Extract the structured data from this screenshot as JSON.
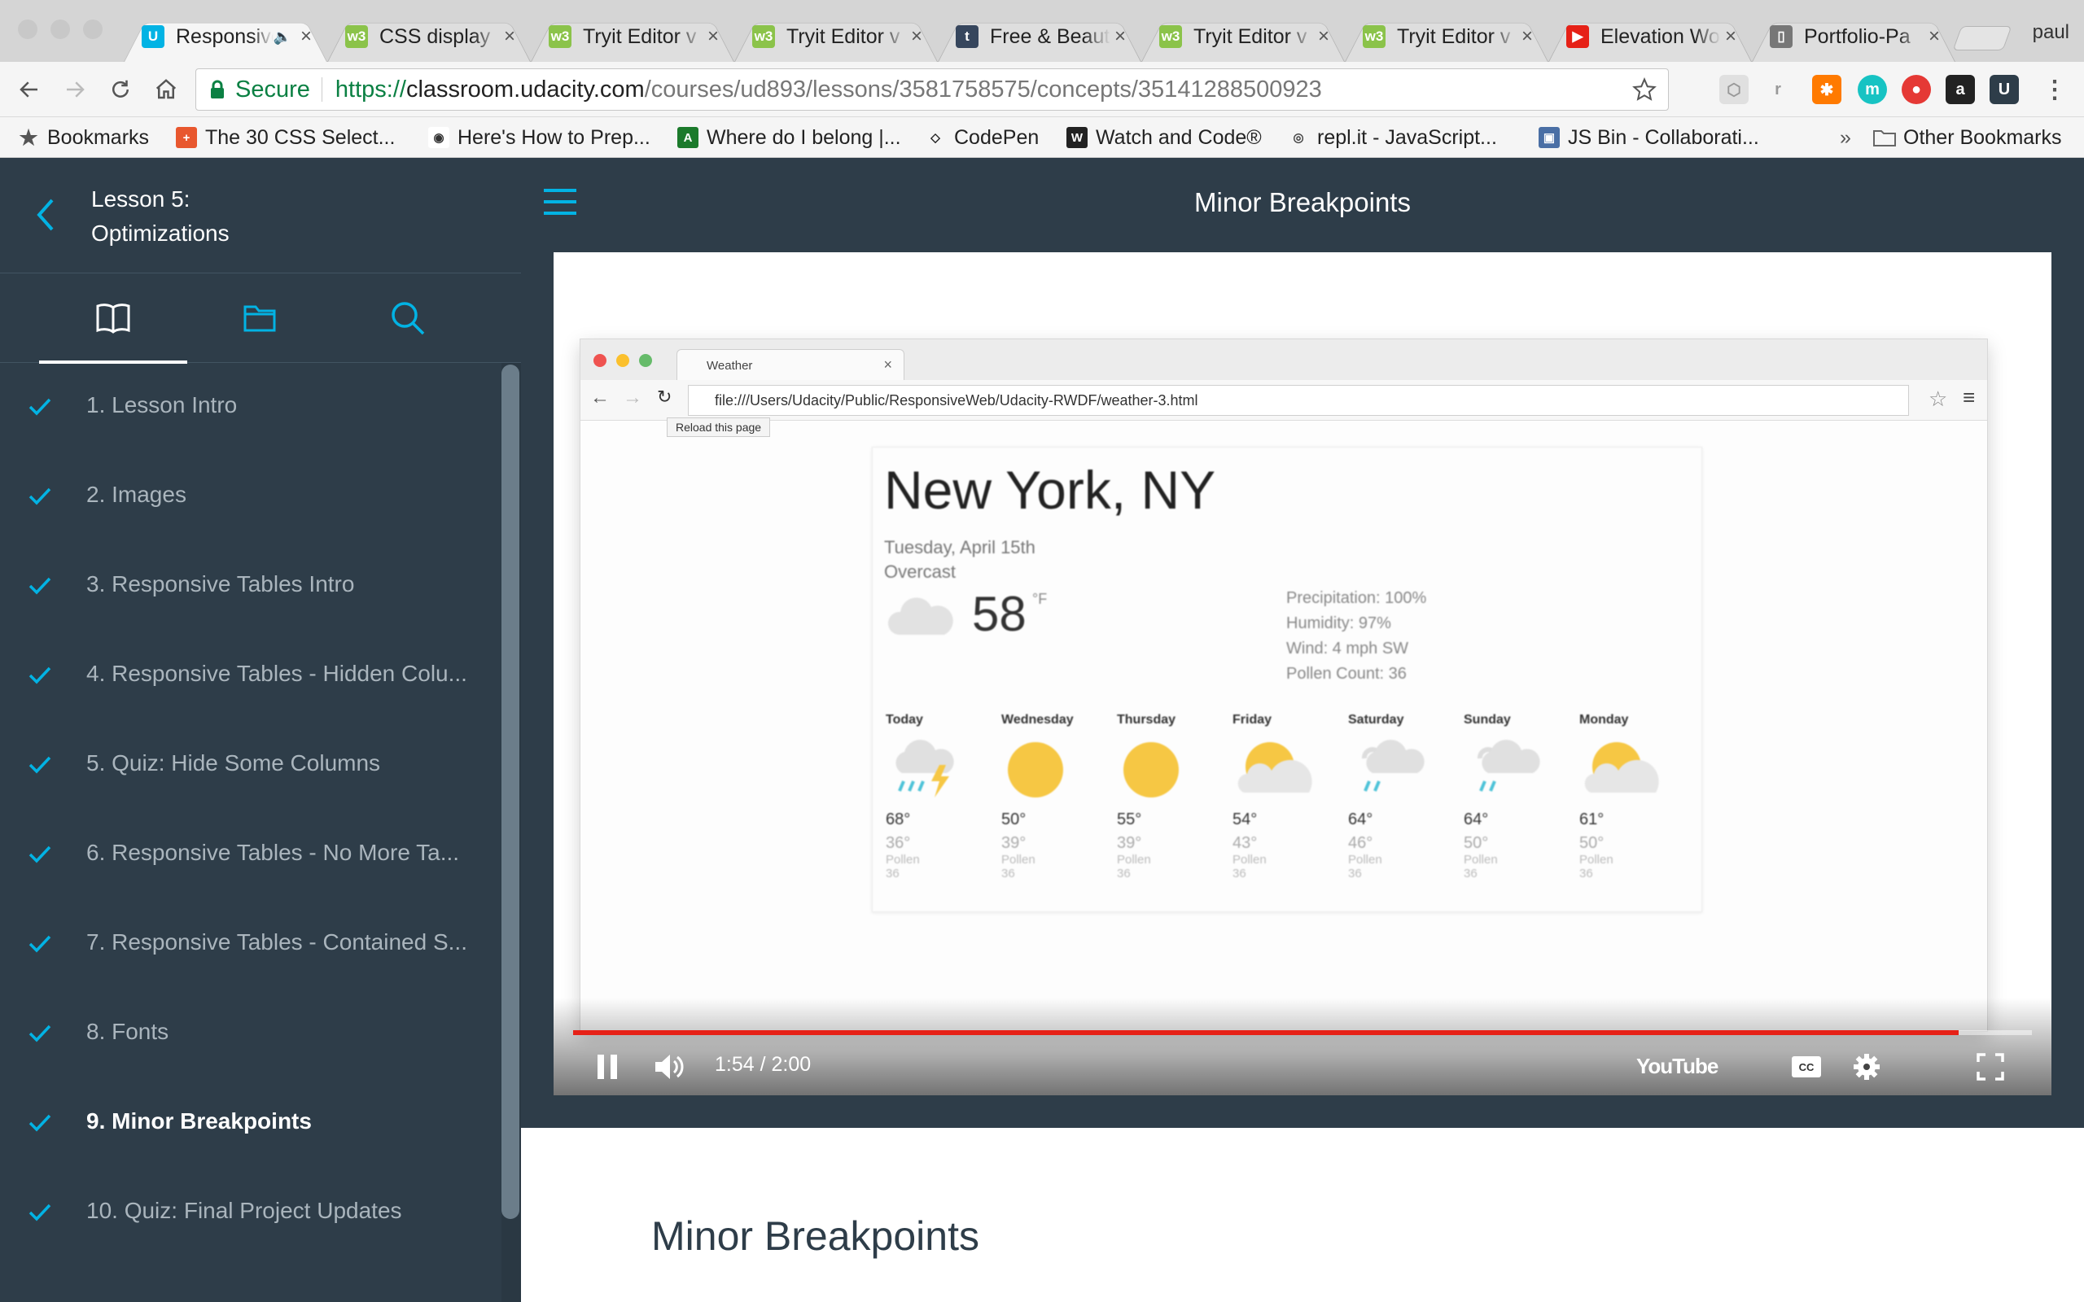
{
  "browser": {
    "profile": "paul",
    "tabs": [
      {
        "title": "Responsive",
        "favicon": "udacity-icon",
        "color": "#02b3e4",
        "active": true,
        "audio": true
      },
      {
        "title": "CSS display",
        "favicon": "w3schools-icon",
        "color": "#8bc34a",
        "active": false
      },
      {
        "title": "Tryit Editor v",
        "favicon": "w3schools-icon",
        "color": "#8bc34a",
        "active": false
      },
      {
        "title": "Tryit Editor v",
        "favicon": "w3schools-icon",
        "color": "#8bc34a",
        "active": false
      },
      {
        "title": "Free & Beaut",
        "favicon": "tumblr-icon",
        "color": "#36465d",
        "active": false
      },
      {
        "title": "Tryit Editor v",
        "favicon": "w3schools-icon",
        "color": "#8bc34a",
        "active": false
      },
      {
        "title": "Tryit Editor v",
        "favicon": "w3schools-icon",
        "color": "#8bc34a",
        "active": false
      },
      {
        "title": "Elevation Wo",
        "favicon": "youtube-icon",
        "color": "#e62117",
        "active": false
      },
      {
        "title": "Portfolio-Pa",
        "favicon": "document-icon",
        "color": "#777777",
        "active": false
      }
    ],
    "secure_label": "Secure",
    "url": {
      "scheme": "https://",
      "host": "classroom.udacity.com",
      "path": "/courses/ud893/lessons/3581758575/concepts/35141288500923"
    },
    "bookmarks": [
      {
        "label": "Bookmarks",
        "icon": "star-icon"
      },
      {
        "label": "The 30 CSS Select...",
        "icon": "plus-icon"
      },
      {
        "label": "Here's How to Prep...",
        "icon": "reddit-icon"
      },
      {
        "label": "Where do I belong |...",
        "icon": "site-icon"
      },
      {
        "label": "CodePen",
        "icon": "codepen-icon"
      },
      {
        "label": "Watch and Code®",
        "icon": "w-icon"
      },
      {
        "label": "repl.it - JavaScript...",
        "icon": "replit-icon"
      },
      {
        "label": "JS Bin - Collaborati...",
        "icon": "jsbin-icon"
      }
    ],
    "overflow": "»",
    "other_bookmarks": "Other Bookmarks"
  },
  "sidebar": {
    "lesson_line1": "Lesson 5:",
    "lesson_line2": "Optimizations",
    "items": [
      {
        "label": "1. Lesson Intro",
        "current": false
      },
      {
        "label": "2. Images",
        "current": false
      },
      {
        "label": "3. Responsive Tables Intro",
        "current": false
      },
      {
        "label": "4. Responsive Tables - Hidden Colu...",
        "current": false
      },
      {
        "label": "5. Quiz: Hide Some Columns",
        "current": false
      },
      {
        "label": "6. Responsive Tables - No More Ta...",
        "current": false
      },
      {
        "label": "7. Responsive Tables - Contained S...",
        "current": false
      },
      {
        "label": "8. Fonts",
        "current": false
      },
      {
        "label": "9. Minor Breakpoints",
        "current": true
      },
      {
        "label": "10. Quiz: Final Project Updates",
        "current": false
      }
    ]
  },
  "main": {
    "title": "Minor Breakpoints",
    "article_heading": "Minor Breakpoints"
  },
  "video": {
    "tab_title": "Weather",
    "url": "file:///Users/Udacity/Public/ResponsiveWeb/Udacity-RWDF/weather-3.html",
    "tooltip": "Reload this page",
    "weather": {
      "city": "New York, NY",
      "date": "Tuesday, April 15th",
      "condition": "Overcast",
      "temp": "58",
      "unit": "°F",
      "precipitation": "Precipitation: 100%",
      "humidity": "Humidity: 97%",
      "wind": "Wind: 4 mph SW",
      "pollen": "Pollen Count: 36",
      "days": [
        {
          "name": "Today",
          "icon": "storm",
          "hi": "68°",
          "lo": "36°",
          "pollen_label": "Pollen",
          "pollen": "36"
        },
        {
          "name": "Wednesday",
          "icon": "sun",
          "hi": "50°",
          "lo": "39°",
          "pollen_label": "Pollen",
          "pollen": "36"
        },
        {
          "name": "Thursday",
          "icon": "sun",
          "hi": "55°",
          "lo": "39°",
          "pollen_label": "Pollen",
          "pollen": "36"
        },
        {
          "name": "Friday",
          "icon": "partly",
          "hi": "54°",
          "lo": "43°",
          "pollen_label": "Pollen",
          "pollen": "36"
        },
        {
          "name": "Saturday",
          "icon": "rain",
          "hi": "64°",
          "lo": "46°",
          "pollen_label": "Pollen",
          "pollen": "36"
        },
        {
          "name": "Sunday",
          "icon": "rain",
          "hi": "64°",
          "lo": "50°",
          "pollen_label": "Pollen",
          "pollen": "36"
        },
        {
          "name": "Monday",
          "icon": "partly",
          "hi": "61°",
          "lo": "50°",
          "pollen_label": "Pollen",
          "pollen": "36"
        }
      ]
    },
    "time": "1:54 / 2:00",
    "progress": 0.95,
    "youtube": "YouTube"
  },
  "colors": {
    "sidebar_bg": "#2e3d49",
    "accent": "#02b3e4",
    "progress": "#e62117"
  }
}
